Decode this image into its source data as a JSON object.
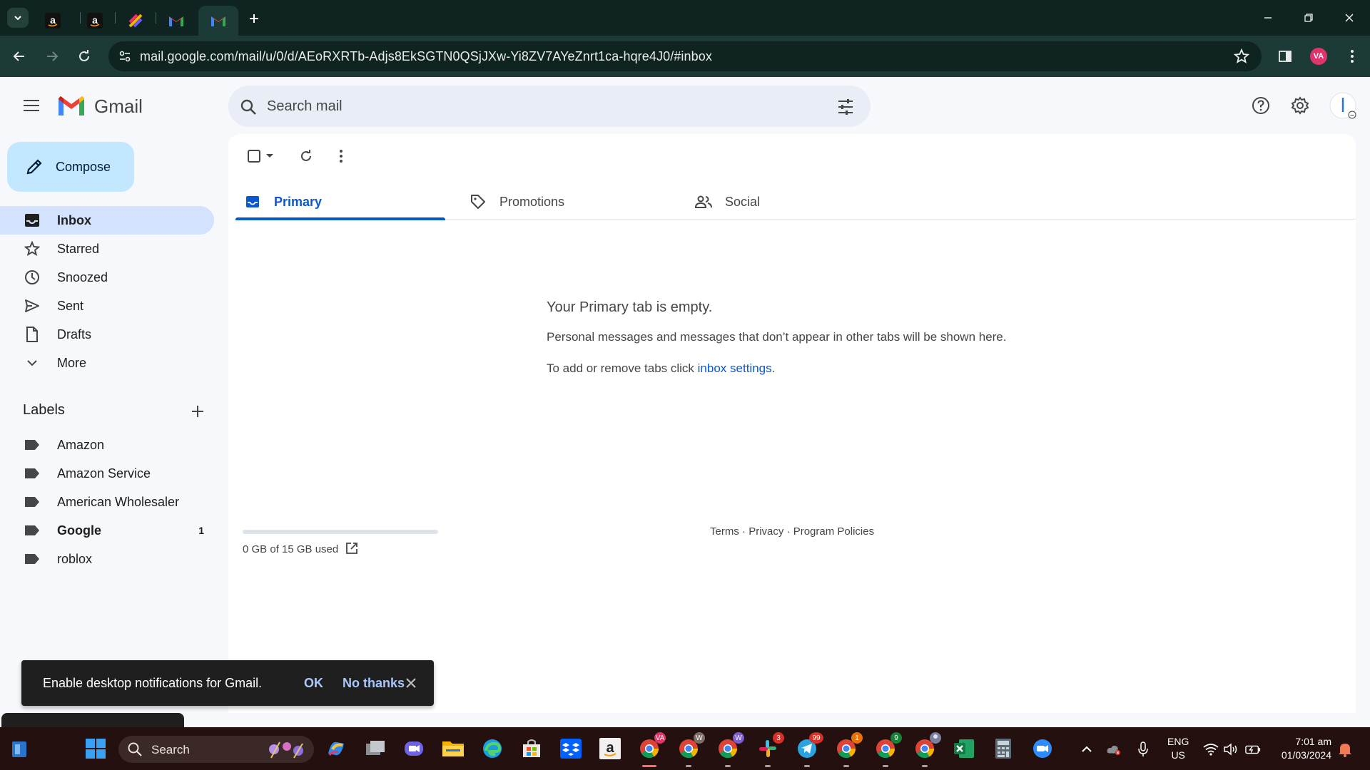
{
  "browser": {
    "tabs": [
      {
        "icon": "amazon-icon"
      },
      {
        "icon": "amazon-icon"
      },
      {
        "icon": "clickup-icon"
      },
      {
        "icon": "gmail-icon"
      },
      {
        "icon": "gmail-icon",
        "active": true
      }
    ],
    "url": "mail.google.com/mail/u/0/d/AEoRXRTb-Adjs8EkSGTN0QSjJXw-Yi8ZV7AYeZnrt1ca-hqre4J0/#inbox",
    "profile_initials": "VA"
  },
  "gmail": {
    "wordmark": "Gmail",
    "search": {
      "placeholder": "Search mail"
    },
    "compose_label": "Compose",
    "nav": [
      {
        "label": "Inbox",
        "icon": "inbox-icon",
        "active": true
      },
      {
        "label": "Starred",
        "icon": "star-icon"
      },
      {
        "label": "Snoozed",
        "icon": "clock-icon"
      },
      {
        "label": "Sent",
        "icon": "send-icon"
      },
      {
        "label": "Drafts",
        "icon": "draft-icon"
      },
      {
        "label": "More",
        "icon": "chevron-down-icon"
      }
    ],
    "labels_title": "Labels",
    "labels": [
      {
        "label": "Amazon",
        "count": ""
      },
      {
        "label": "Amazon Service",
        "count": ""
      },
      {
        "label": "American Wholesaler",
        "count": ""
      },
      {
        "label": "Google",
        "count": "1",
        "bold": true
      },
      {
        "label": "roblox",
        "count": ""
      }
    ],
    "tabs": [
      {
        "label": "Primary",
        "icon": "inbox-tab-icon",
        "active": true
      },
      {
        "label": "Promotions",
        "icon": "tag-icon"
      },
      {
        "label": "Social",
        "icon": "people-icon"
      }
    ],
    "empty": {
      "title": "Your Primary tab is empty.",
      "line1": "Personal messages and messages that don’t appear in other tabs will be shown here.",
      "line2_prefix": "To add or remove tabs click ",
      "line2_link": "inbox settings",
      "line2_suffix": "."
    },
    "storage": {
      "text": "0 GB of 15 GB used",
      "fraction": 0.0
    },
    "footer": {
      "terms": "Terms",
      "privacy": "Privacy",
      "policies": "Program Policies",
      "sep": " · "
    },
    "snackbar": {
      "message": "Enable desktop notifications for Gmail.",
      "ok": "OK",
      "no": "No thanks"
    }
  },
  "taskbar": {
    "search_label": "Search",
    "lang_line1": "ENG",
    "lang_line2": "US",
    "time": "7:01 am",
    "date": "01/03/2024",
    "badges": {
      "chrome_va": "VA",
      "chrome_w1": "W",
      "chrome_w2": "W",
      "slack": "3",
      "telegram": "99",
      "chrome_1": "1",
      "chrome_9": "9"
    }
  },
  "colors": {
    "accent": "#0b57d0",
    "compose": "#c2e7ff",
    "active_nav": "#d3e3fd",
    "chrome_dark": "#0f2320",
    "chrome_toolbar": "#1d3b36"
  }
}
